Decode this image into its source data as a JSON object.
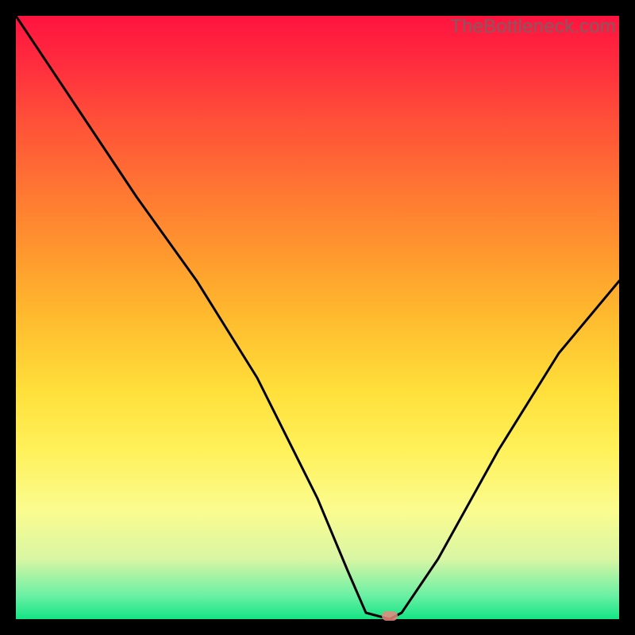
{
  "watermark": "TheBottleneck.com",
  "colors": {
    "frame": "#000000",
    "gradient_top": "#ff133f",
    "gradient_bottom": "#14e585",
    "curve": "#000000",
    "marker": "#e9887e"
  },
  "chart_data": {
    "type": "line",
    "title": "",
    "xlabel": "",
    "ylabel": "",
    "xlim": [
      0,
      100
    ],
    "ylim": [
      0,
      100
    ],
    "grid": false,
    "legend": false,
    "series": [
      {
        "name": "bottleneck-curve",
        "x": [
          0,
          10,
          20,
          30,
          40,
          50,
          55,
          58,
          62,
          64,
          70,
          80,
          90,
          100
        ],
        "y": [
          100,
          85,
          70,
          56,
          40,
          20,
          8,
          1,
          0,
          1,
          10,
          28,
          44,
          56
        ]
      }
    ],
    "marker": {
      "x": 62,
      "y": 0
    }
  }
}
